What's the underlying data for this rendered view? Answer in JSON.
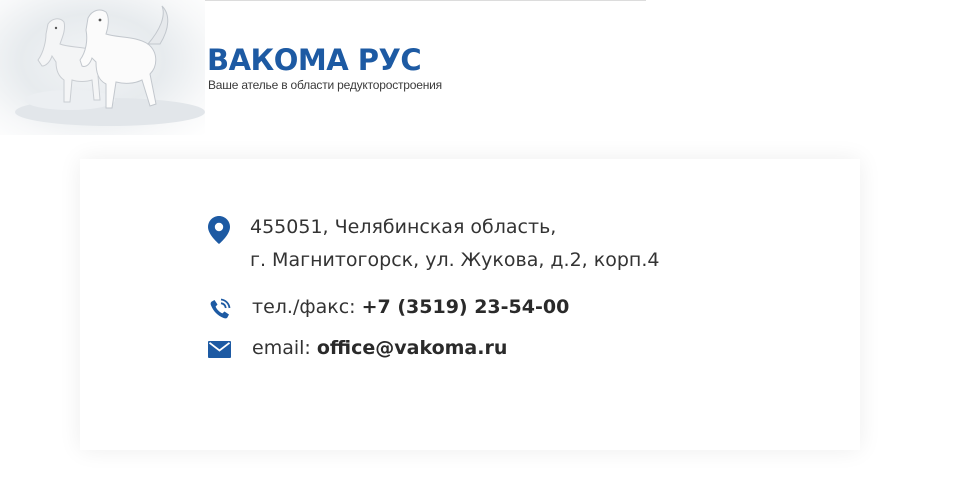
{
  "header": {
    "logo_text": "ВАКОМА РУС",
    "tagline": "Ваше ателье в области редукторостроения"
  },
  "contacts": {
    "address_line1": "455051, Челябинская область,",
    "address_line2": "г. Магнитогорск, ул. Жукова, д.2, корп.4",
    "phone_label": "тел./факс:",
    "phone_value": "+7 (3519) 23-54-00",
    "email_label": "email:",
    "email_value": "office@vakoma.ru"
  },
  "icons": {
    "hero": "horses-image",
    "address": "map-pin-icon",
    "phone": "phone-icon",
    "email": "envelope-icon"
  },
  "colors": {
    "brand": "#1d5aa3",
    "text": "#333333"
  }
}
